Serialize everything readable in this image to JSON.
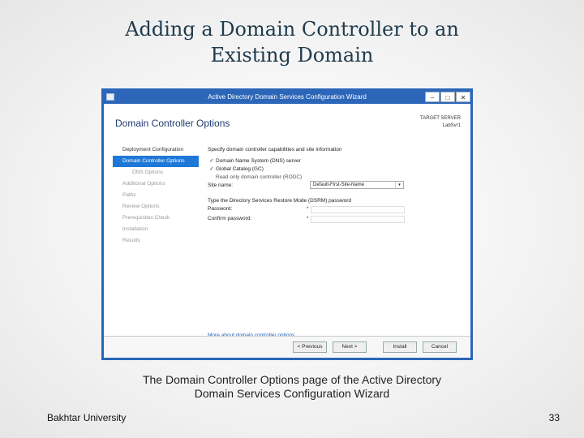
{
  "slide": {
    "title_line1": "Adding a Domain Controller to an",
    "title_line2": "Existing Domain",
    "caption_line1": "The Domain Controller Options page of the Active Directory",
    "caption_line2": "Domain Services Configuration Wizard",
    "footer_left": "Bakhtar University",
    "page_number": "33"
  },
  "window": {
    "title": "Active Directory Domain Services Configuration Wizard",
    "controls": {
      "minimize": "–",
      "maximize": "□",
      "close": "✕"
    },
    "page_heading": "Domain Controller Options",
    "target_label": "TARGET SERVER",
    "target_value": "LabSvr1",
    "nav": [
      "Deployment Configuration",
      "Domain Controller Options",
      "DNS Options",
      "Additional Options",
      "Paths",
      "Review Options",
      "Prerequisites Check",
      "Installation",
      "Results"
    ],
    "content": {
      "intro": "Specify domain controller capabilities and site information",
      "dns_label": "Domain Name System (DNS) server",
      "gc_label": "Global Catalog (GC)",
      "rodc_label": "Read only domain controller (RODC)",
      "site_label": "Site name:",
      "site_value": "Default-First-Site-Name",
      "dsrm_prompt": "Type the Directory Services Restore Mode (DSRM) password",
      "password_label": "Password:",
      "confirm_label": "Confirm password:",
      "required_mark": "*",
      "check_mark": "✓",
      "caret": "▾"
    },
    "more_link": "More about domain controller options",
    "buttons": {
      "previous": "< Previous",
      "next": "Next >",
      "install": "Install",
      "cancel": "Cancel"
    }
  }
}
